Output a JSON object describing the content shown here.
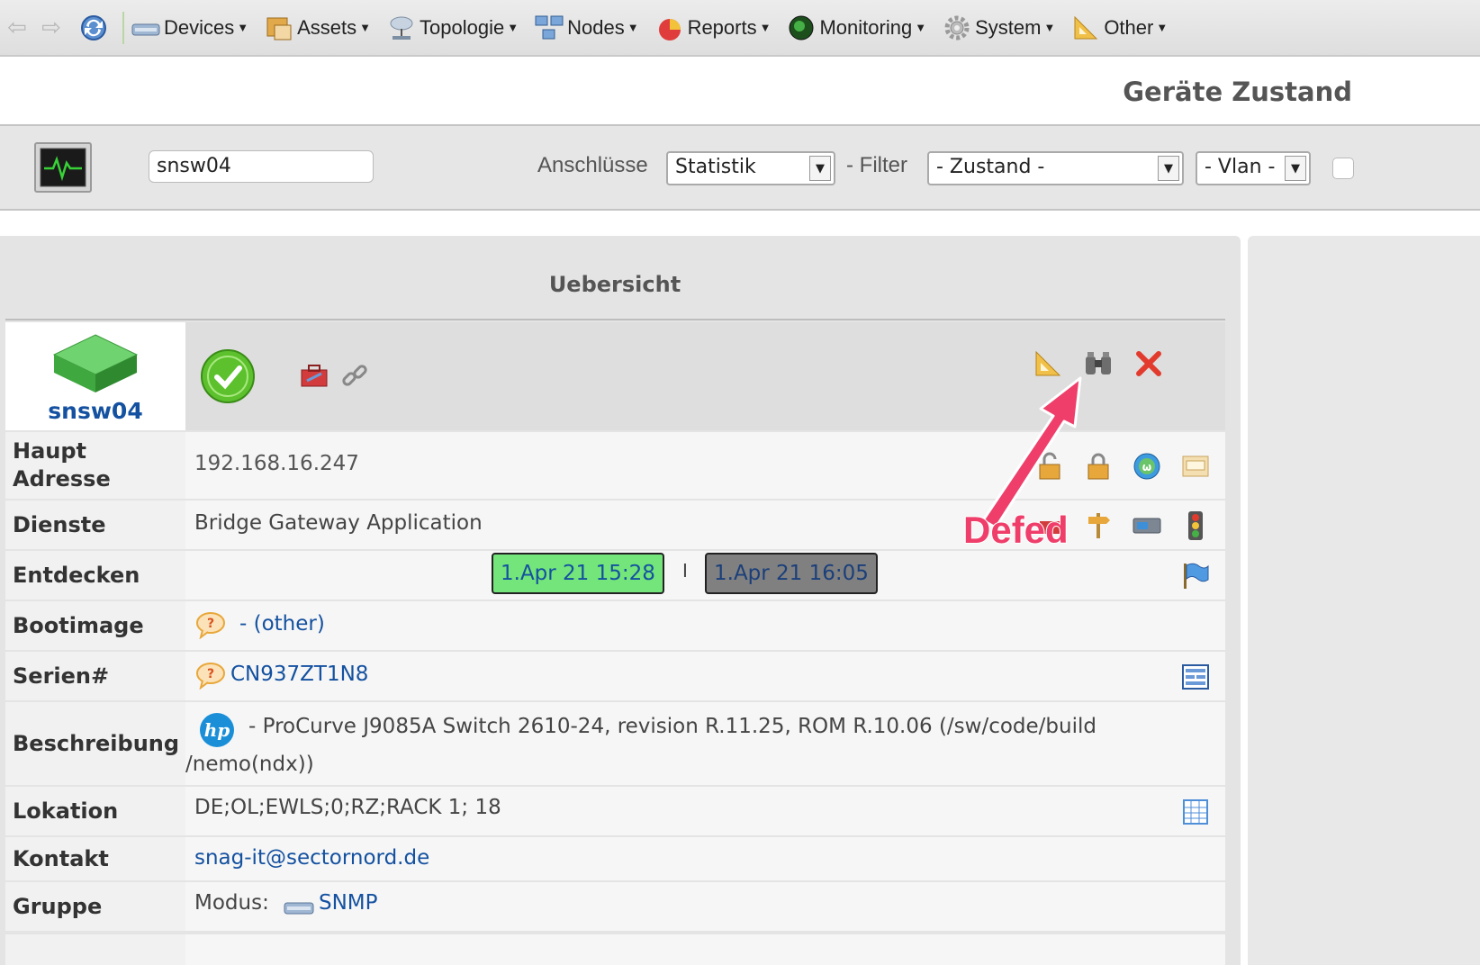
{
  "menu": {
    "items": [
      {
        "label": "Devices",
        "icon": "device-icon"
      },
      {
        "label": "Assets",
        "icon": "assets-icon"
      },
      {
        "label": "Topologie",
        "icon": "topology-icon"
      },
      {
        "label": "Nodes",
        "icon": "nodes-icon"
      },
      {
        "label": "Reports",
        "icon": "reports-icon"
      },
      {
        "label": "Monitoring",
        "icon": "monitoring-icon"
      },
      {
        "label": "System",
        "icon": "gear-icon"
      },
      {
        "label": "Other",
        "icon": "ruler-icon"
      }
    ]
  },
  "page": {
    "title": "Geräte Zustand"
  },
  "toolbar": {
    "device_value": "snsw04",
    "anschluesse_label": "Anschlüsse",
    "anschluesse_value": "Statistik",
    "filter_label": "- Filter",
    "zustand_value": "- Zustand -",
    "vlan_value": "- Vlan -"
  },
  "overview": {
    "title": "Uebersicht",
    "device_name": "snsw04",
    "rows": {
      "haupt_label": "Haupt Adresse",
      "haupt_value": "192.168.16.247",
      "dienste_label": "Dienste",
      "dienste_value": "Bridge Gateway Application",
      "entdecken_label": "Entdecken",
      "entdecken_first": "1.Apr 21 15:28",
      "entdecken_sep": "I",
      "entdecken_last": "1.Apr 21 16:05",
      "bootimage_label": "Bootimage",
      "bootimage_value": "- (other)",
      "serien_label": "Serien#",
      "serien_value": "CN937ZT1N8",
      "beschreibung_label": "Beschreibung",
      "beschreibung_line1": "- ProCurve J9085A Switch 2610-24, revision R.11.25, ROM R.10.06 (/sw/code/build",
      "beschreibung_line2": "/nemo(ndx))",
      "lokation_label": "Lokation",
      "lokation_value": "DE;OL;EWLS;0;RZ;RACK 1; 18",
      "kontakt_label": "Kontakt",
      "kontakt_value": "snag-it@sectornord.de",
      "gruppe_label": "Gruppe",
      "gruppe_modus": "Modus:",
      "gruppe_value": "SNMP"
    }
  },
  "annotation": {
    "text": "Defed",
    "color": "#ef3e6a"
  },
  "colors": {
    "accent": "#1451a0",
    "green_date": "#73e57a",
    "gray_date": "#808080"
  }
}
